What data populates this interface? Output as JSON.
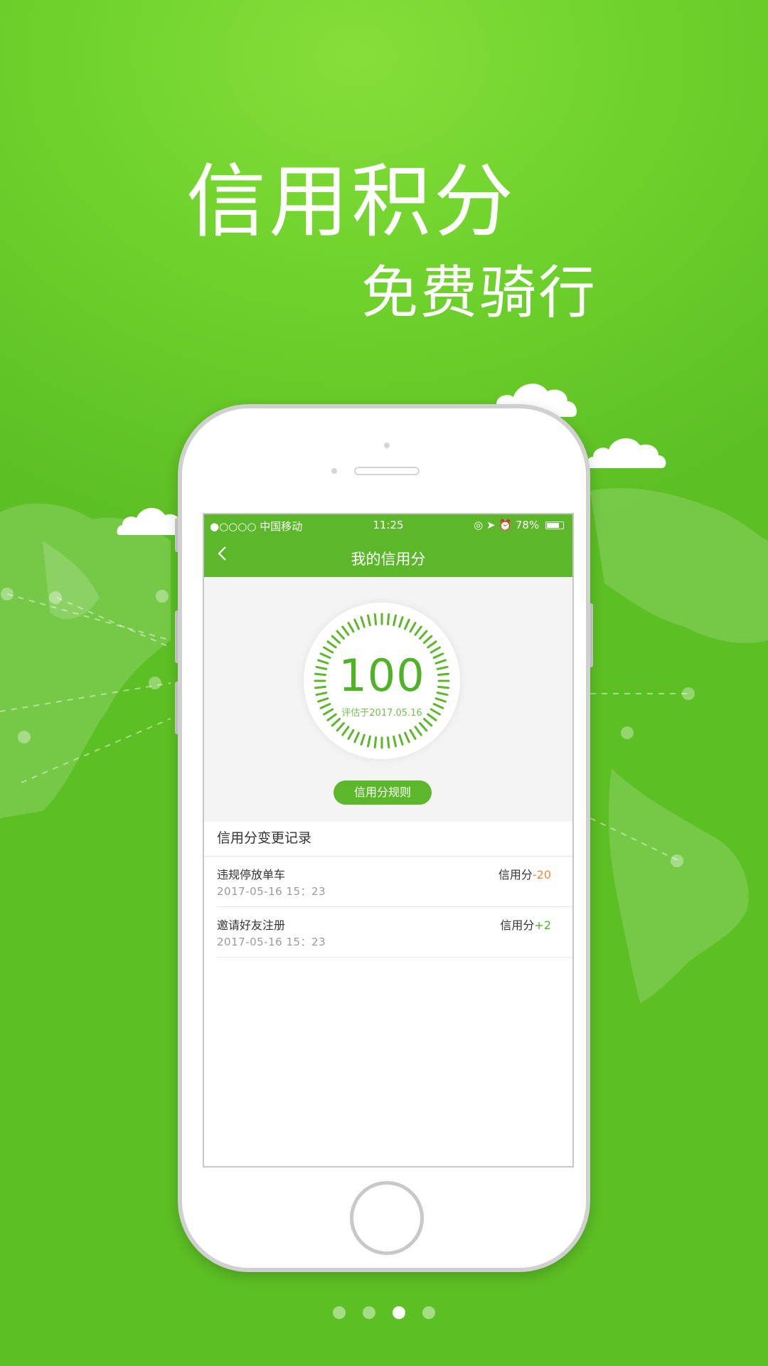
{
  "hero": {
    "line1": "信用积分",
    "line2": "免费骑行"
  },
  "status_bar": {
    "carrier": "●○○○○ 中国移动",
    "time": "11:25",
    "battery": "78%"
  },
  "nav": {
    "back_icon": "chevron-left-icon",
    "title": "我的信用分"
  },
  "score": {
    "value": "100",
    "date": "评估于2017.05.16",
    "rules_button": "信用分规则"
  },
  "records": {
    "title": "信用分变更记录",
    "items": [
      {
        "name": "违规停放单车",
        "time": "2017-05-16 15：23",
        "label": "信用分",
        "delta": "-20"
      },
      {
        "name": "邀请好友注册",
        "time": "2017-05-16 15：23",
        "label": "信用分",
        "delta": "+2"
      }
    ]
  },
  "pagination": {
    "total": 4,
    "active_index": 2
  },
  "colors": {
    "brand_green": "#5cb82a",
    "negative": "#f08a3c",
    "positive": "#4fb227"
  }
}
